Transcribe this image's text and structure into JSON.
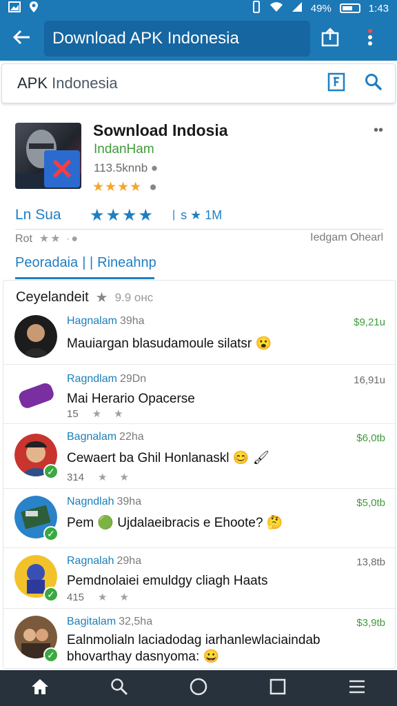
{
  "status_bar": {
    "battery": "49%",
    "time": "1:43"
  },
  "app_bar": {
    "title": "Download APK Indonesia"
  },
  "search": {
    "brand": "APK",
    "text": "Indonesia"
  },
  "app": {
    "title": "Sownload Indosia",
    "developer": "IndanHam",
    "size": "113.5knnb",
    "rating_stars": "★★★★",
    "stat_label": "Ln Sua",
    "stat_stars": "★★★★",
    "stat_count": "1M",
    "meta_left": "Rot",
    "meta_right": "Iedgam Ohearl",
    "tabs": [
      "Peoradaia",
      "Rineahnp"
    ]
  },
  "comments": {
    "header": "Ceyelandeit",
    "header_sub": "9.9 oнс",
    "items": [
      {
        "name": "Hagnalam",
        "time": "39ha",
        "amount": "$9,21u",
        "amount_green": true,
        "text": "Mauiargan blasudamoule silatsr 😮",
        "sub": ""
      },
      {
        "name": "Ragndlam",
        "time": "29Dn",
        "amount": "16,91u",
        "amount_green": false,
        "text": "Mai Herario Opacerse",
        "sub": "15"
      },
      {
        "name": "Bagnalam",
        "time": "22ha",
        "amount": "$6,0tb",
        "amount_green": true,
        "text": "Cewaert ba Ghil Honlanaskl 😊 🖌",
        "sub": "314"
      },
      {
        "name": "Nagndlah",
        "time": "39ha",
        "amount": "$5,0tb",
        "amount_green": true,
        "text": "Pem 🟢 Ujdalaeibracis e Ehoote? 🤔",
        "sub": ""
      },
      {
        "name": "Ragnalah",
        "time": "29ha",
        "amount": "13,8tb",
        "amount_green": false,
        "text": "Pemdnolaiei emuldgy cliagh Haats",
        "sub": "415"
      },
      {
        "name": "Bagitalam",
        "time": "32,5ha",
        "amount": "$3,9tb",
        "amount_green": true,
        "text": "Ealnmolialn laciadodag iarhanlewlaciaindab bhovarthay dasnyoma: 😀",
        "sub": ""
      }
    ]
  },
  "bottom_nav": [
    "home-icon",
    "search-icon",
    "circle-icon",
    "square-icon",
    "menu-icon"
  ]
}
